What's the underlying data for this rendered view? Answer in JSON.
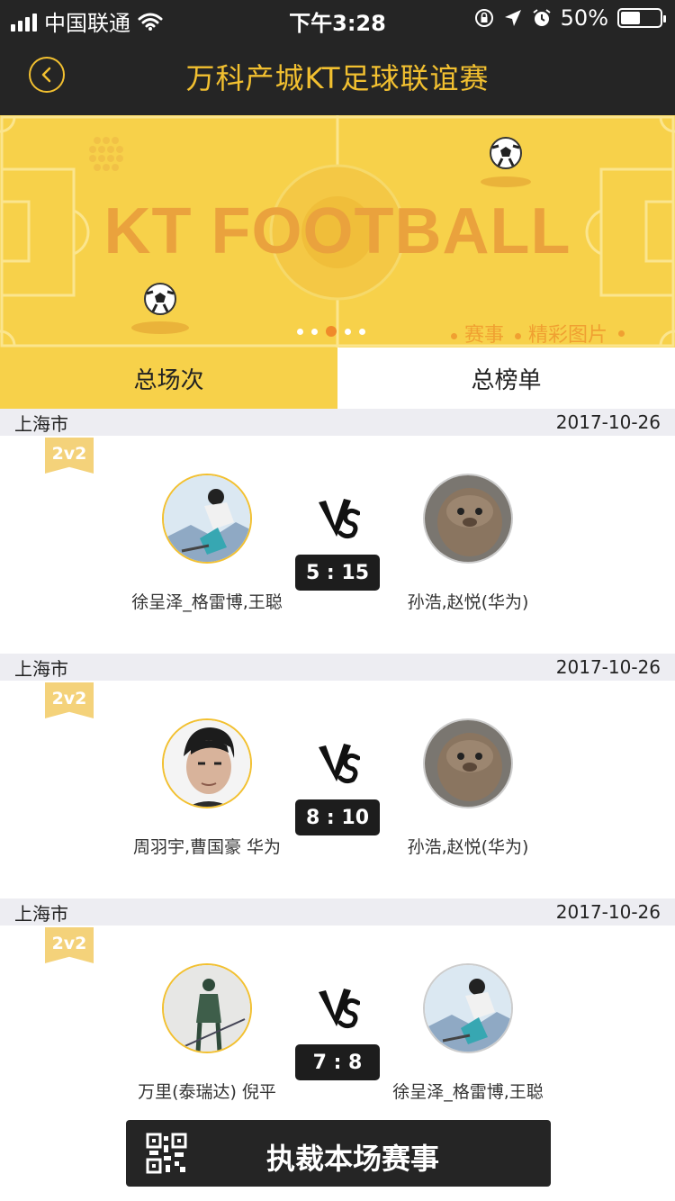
{
  "status_bar": {
    "carrier": "中国联通",
    "time": "下午3:28",
    "battery": "50%",
    "battery_level": 0.5
  },
  "nav": {
    "title": "万科产城KT足球联谊赛",
    "back_icon": "chevron-left-icon"
  },
  "banner": {
    "title": "KT FOOTBALL",
    "link_1": "赛事",
    "link_2": "精彩图片",
    "active_slide": 3,
    "slide_count": 5
  },
  "tabs": [
    {
      "label": "总场次",
      "active": true
    },
    {
      "label": "总榜单",
      "active": false
    }
  ],
  "matches": [
    {
      "city": "上海市",
      "date": "2017-10-26",
      "format": "2v2",
      "score": "5 : 15",
      "team_left": "徐呈泽_格雷博,王聪",
      "team_right": "孙浩,赵悦(华为)"
    },
    {
      "city": "上海市",
      "date": "2017-10-26",
      "format": "2v2",
      "score": "8 : 10",
      "team_left": "周羽宇,曹国豪 华为",
      "team_right": "孙浩,赵悦(华为)"
    },
    {
      "city": "上海市",
      "date": "2017-10-26",
      "format": "2v2",
      "score": "7 : 8",
      "team_left": "万里(泰瑞达) 倪平",
      "team_right": "徐呈泽_格雷博,王聪"
    }
  ],
  "bottom_button": {
    "label": "执裁本场赛事",
    "icon": "qr-code-icon"
  },
  "colors": {
    "accent": "#f2c030",
    "banner_yellow": "#f7d14a",
    "dark": "#252525",
    "orange": "#eaa23d"
  }
}
